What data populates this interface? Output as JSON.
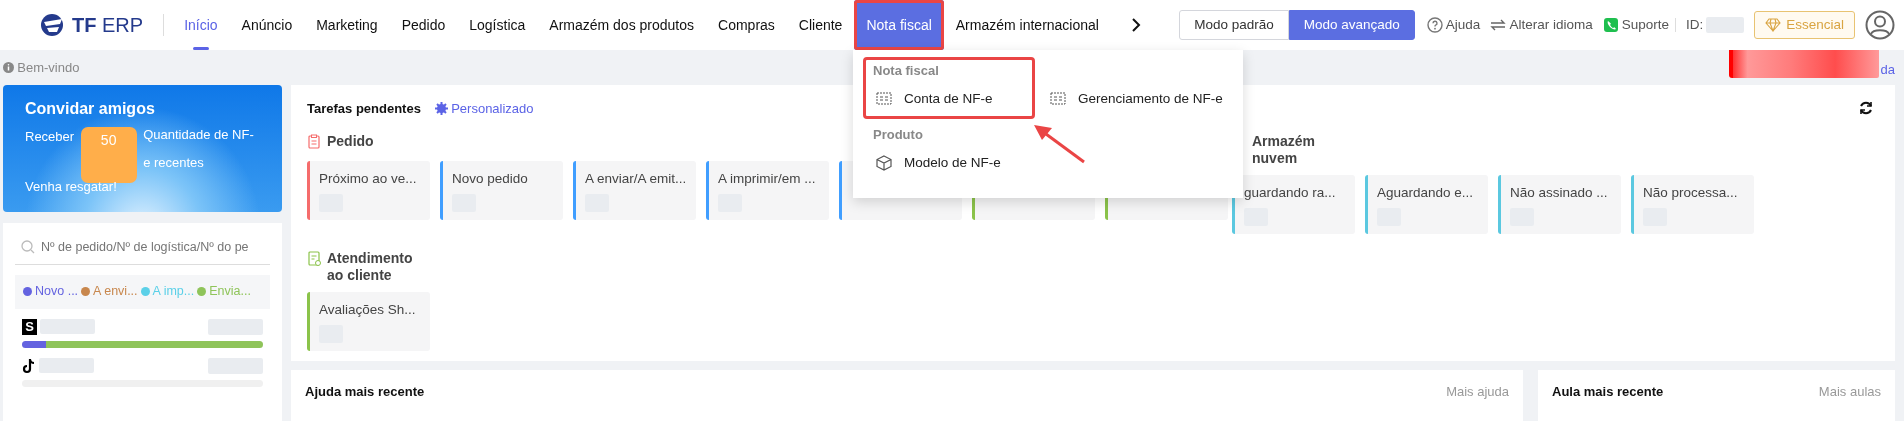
{
  "top_nav": {
    "logo_bold": "TF",
    "logo_light": "ERP",
    "items": [
      {
        "label": "Início",
        "selected": true,
        "open": false
      },
      {
        "label": "Anúncio",
        "selected": false,
        "open": false
      },
      {
        "label": "Marketing",
        "selected": false,
        "open": false
      },
      {
        "label": "Pedido",
        "selected": false,
        "open": false
      },
      {
        "label": "Logística",
        "selected": false,
        "open": false
      },
      {
        "label": "Armazém dos produtos",
        "selected": false,
        "open": false
      },
      {
        "label": "Compras",
        "selected": false,
        "open": false
      },
      {
        "label": "Cliente",
        "selected": false,
        "open": false
      },
      {
        "label": "Nota fiscal",
        "selected": false,
        "open": true
      },
      {
        "label": "Armazém internacional",
        "selected": false,
        "open": false
      }
    ],
    "modes": [
      {
        "label": "Modo padrão",
        "selected": false
      },
      {
        "label": "Modo avançado",
        "selected": true
      }
    ],
    "links": [
      {
        "kind": "help",
        "label": "Ajuda"
      },
      {
        "kind": "language",
        "label": "Alterar idioma"
      },
      {
        "kind": "support",
        "label": "Suporte"
      }
    ],
    "id_label": "ID:",
    "plan": "Essencial"
  },
  "dropdown": {
    "pointer_arrow": true,
    "sections": [
      {
        "title": "Nota fiscal",
        "highlighted": true,
        "items": [
          {
            "label": "Conta de NF-e",
            "kind": "invoice"
          },
          {
            "label": "Gerenciamento de NF-e",
            "kind": "invoice"
          }
        ]
      },
      {
        "title": "Produto",
        "highlighted": false,
        "items": [
          {
            "label": "Modelo de NF-e",
            "kind": "product"
          }
        ]
      }
    ]
  },
  "welcome": "Bem-vindo",
  "corner_link": "da",
  "invite": {
    "title": "Convidar amigos",
    "prefix": "Receber",
    "amount": "50",
    "suffix": "Quantidade de NF-e recentes",
    "cta": "Venha resgatar!"
  },
  "order_search": {
    "placeholder": "Nº de pedido/Nº de logística/Nº do pe",
    "legend": [
      {
        "label": "Novo ...",
        "color": "#6463e0"
      },
      {
        "label": "A envi...",
        "color": "#c8874d"
      },
      {
        "label": "A imp...",
        "color": "#5bd0e8"
      },
      {
        "label": "Envia...",
        "color": "#8fc45a"
      }
    ],
    "stores": [
      {
        "kind": "letter",
        "logo": "S",
        "segments": [
          {
            "color": "#6463e0",
            "level": 0.1
          },
          {
            "color": "#8fc45a",
            "level": 0.9
          }
        ]
      },
      {
        "kind": "tiktok"
      }
    ]
  },
  "tasks": {
    "title": "Tarefas pendentes",
    "customize": "Personalizado",
    "groups": [
      {
        "title": "Pedido",
        "kind": "order",
        "cards": [
          {
            "label": "Próximo ao ve...",
            "color": "#f56c6c"
          },
          {
            "label": "Novo pedido",
            "color": "#409eff"
          },
          {
            "label": "A enviar/A emit...",
            "color": "#409eff"
          },
          {
            "label": "A imprimir/em ...",
            "color": "#409eff"
          },
          {
            "color": "#409eff"
          },
          {
            "color": "#8bc34a"
          },
          {
            "color": "#8bc34a"
          }
        ]
      },
      {
        "title": "Armazém nuvem",
        "kind": "warehouse",
        "cards": [
          {
            "label": "guardando ra...",
            "color": "#5bc8e0"
          },
          {
            "label": "Aguardando e...",
            "color": "#5bc8e0"
          },
          {
            "label": "Não assinado ...",
            "color": "#5bc8e0"
          },
          {
            "label": "Não processa...",
            "color": "#5bc8e0"
          }
        ]
      },
      {
        "title": "Atendimento ao cliente",
        "kind": "service",
        "cards": [
          {
            "label": "Avaliações Sh...",
            "color": "#8bc34a"
          }
        ]
      }
    ]
  },
  "help_panel": {
    "title": "Ajuda mais recente",
    "more": "Mais ajuda"
  },
  "class_panel": {
    "title": "Aula mais recente",
    "more": "Mais aulas"
  }
}
